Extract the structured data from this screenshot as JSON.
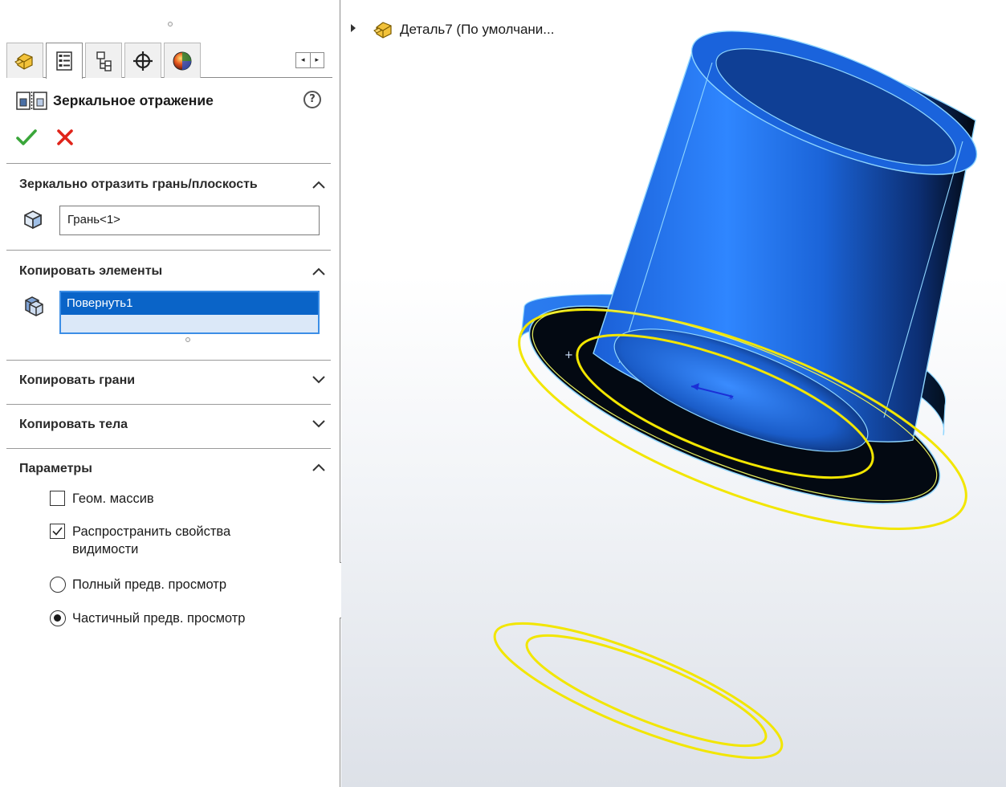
{
  "property_manager": {
    "title": "Зеркальное отражение",
    "help_icon_glyph": "?",
    "ok_icon": "checkmark-icon",
    "cancel_icon": "close-icon",
    "tabs": [
      {
        "icon": "feature-manager-icon"
      },
      {
        "icon": "property-manager-icon",
        "active": true
      },
      {
        "icon": "configuration-manager-icon"
      },
      {
        "icon": "dimxpert-icon"
      },
      {
        "icon": "display-manager-icon"
      }
    ],
    "tab_scroll": {
      "left": "◂",
      "right": "▸"
    },
    "sections": {
      "mirror_face": {
        "title": "Зеркально отразить грань/плоскость",
        "expanded": true,
        "value": "Грань<1>"
      },
      "features": {
        "title": "Копировать элементы",
        "expanded": true,
        "items": [
          "Повернуть1"
        ]
      },
      "faces": {
        "title": "Копировать грани",
        "expanded": false
      },
      "bodies": {
        "title": "Копировать тела",
        "expanded": false
      },
      "options": {
        "title": "Параметры",
        "expanded": true,
        "geometry_pattern": {
          "label": "Геом. массив",
          "checked": false
        },
        "propagate_visual": {
          "label_line1": "Распространить свойства",
          "label_line2": "видимости",
          "checked": true
        },
        "full_preview": {
          "label": "Полный предв. просмотр",
          "selected": false
        },
        "partial_preview": {
          "label": "Частичный предв. просмотр",
          "selected": true
        }
      }
    }
  },
  "feature_tree": {
    "root_label": "Деталь7  (По умолчани..."
  },
  "colors": {
    "model_blue": "#1f6fe0",
    "selection_yellow": "#f2e600",
    "edge_cyan": "#8fd6ff"
  }
}
